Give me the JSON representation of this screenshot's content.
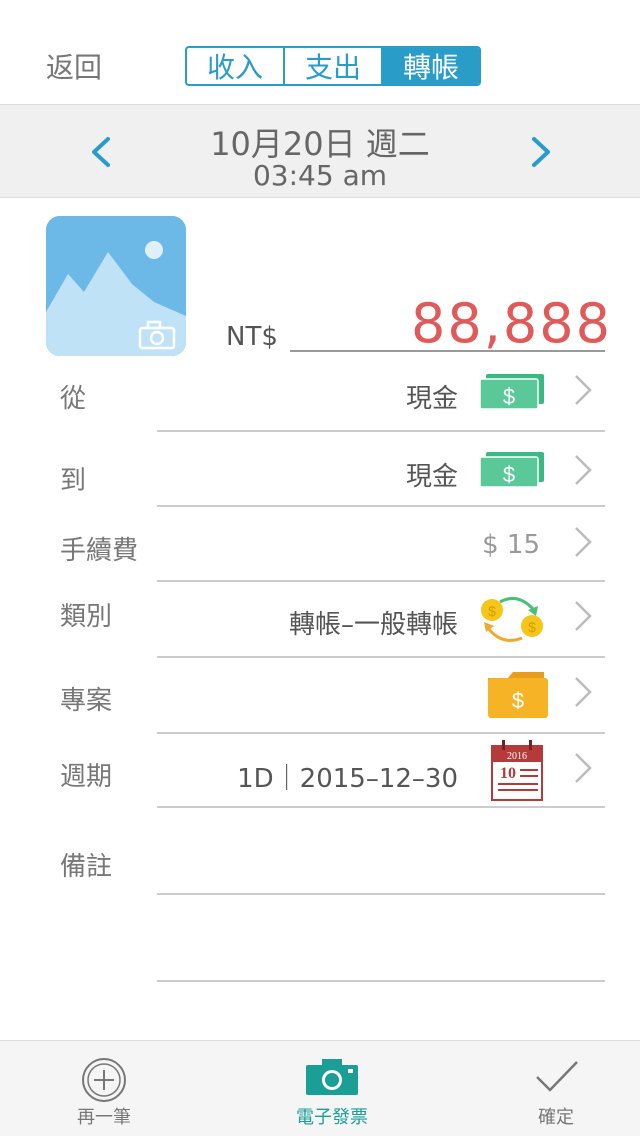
{
  "header": {
    "back_label": "返回",
    "tabs": [
      {
        "label": "收入",
        "active": false
      },
      {
        "label": "支出",
        "active": false
      },
      {
        "label": "轉帳",
        "active": true
      }
    ],
    "accent_color": "#2a9cc8"
  },
  "datebar": {
    "date": "10月20日 週二",
    "time": "03:45  am",
    "prev_icon": "chevron-left-icon",
    "next_icon": "chevron-right-icon"
  },
  "amount": {
    "currency": "NT$",
    "value": "88,888",
    "color": "#e05a5a"
  },
  "rows": {
    "from": {
      "label": "從",
      "value": "現金",
      "icon": "cash-icon"
    },
    "to": {
      "label": "到",
      "value": "現金",
      "icon": "cash-icon"
    },
    "fee": {
      "label": "手續費",
      "value": "$ 15"
    },
    "category": {
      "label": "類別",
      "value": "轉帳–一般轉帳",
      "icon": "transfer-coins-icon"
    },
    "project": {
      "label": "專案",
      "value": "",
      "icon": "folder-dollar-icon"
    },
    "period": {
      "label": "週期",
      "value": "1D｜2015–12–30",
      "icon": "calendar-icon",
      "calendar_year": "2016",
      "calendar_day": "10"
    },
    "note": {
      "label": "備註",
      "value": ""
    }
  },
  "tabbar": {
    "add_label": "再一筆",
    "einvoice_label": "電子發票",
    "confirm_label": "確定",
    "einvoice_color": "#1a9e96"
  }
}
